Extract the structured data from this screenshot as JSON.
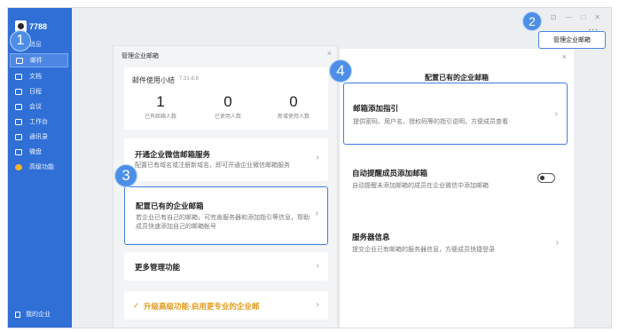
{
  "sidebar": {
    "user_name": "7788",
    "items": [
      {
        "label": "消息"
      },
      {
        "label": "邮件"
      },
      {
        "label": "文档"
      },
      {
        "label": "日程"
      },
      {
        "label": "会议"
      },
      {
        "label": "工作台"
      },
      {
        "label": "通讯录"
      },
      {
        "label": "微盘"
      },
      {
        "label": "高级功能"
      }
    ],
    "enterprise": "我的企业"
  },
  "steps": [
    "1",
    "2",
    "3",
    "4"
  ],
  "menu": {
    "manage_label": "管理企业邮箱",
    "more": "..."
  },
  "window_controls": {
    "pin": "⊡",
    "min": "—",
    "max": "□",
    "close": "✕"
  },
  "dialog_left": {
    "title": "管理企业邮箱",
    "close": "×",
    "stats": {
      "title": "邮件使用小结",
      "date": "7.31-8.6",
      "items": [
        {
          "value": "1",
          "label": "已有邮箱人数"
        },
        {
          "value": "0",
          "label": "已使用人数"
        },
        {
          "value": "0",
          "label": "新增使用人数"
        }
      ]
    },
    "open_service": {
      "title": "开通企业微信邮箱服务",
      "desc": "配置已有域名或注册新域名，即可开通企业微信邮箱服务"
    },
    "config_existing": {
      "title": "配置已有的企业邮箱",
      "desc": "若企业已有自己的邮箱，可完善服务器和添加指引等信息，帮助成员快速添加自己的邮箱帐号"
    },
    "more_features": {
      "title": "更多管理功能"
    },
    "upgrade": {
      "title": "升级高级功能·启用更专业的企业邮"
    }
  },
  "panel_right": {
    "title": "配置已有的企业邮箱",
    "close": "×",
    "guide": {
      "title": "邮箱添加指引",
      "desc": "提供密码、用户名、授权码等的指引说明，方便成员查看"
    },
    "remind": {
      "title": "自动提醒成员添加邮箱",
      "desc": "自动提醒未添加邮箱的成员在企业微信中添加邮箱",
      "toggle_on": false
    },
    "server": {
      "title": "服务器信息",
      "desc": "提交企业已有邮箱的服务器信息，方便成员快捷登录"
    }
  },
  "chevron": "›",
  "colors": {
    "sidebar": "#2f6fd6",
    "highlight": "#3e7fe0",
    "upgrade": "#e09a18"
  }
}
